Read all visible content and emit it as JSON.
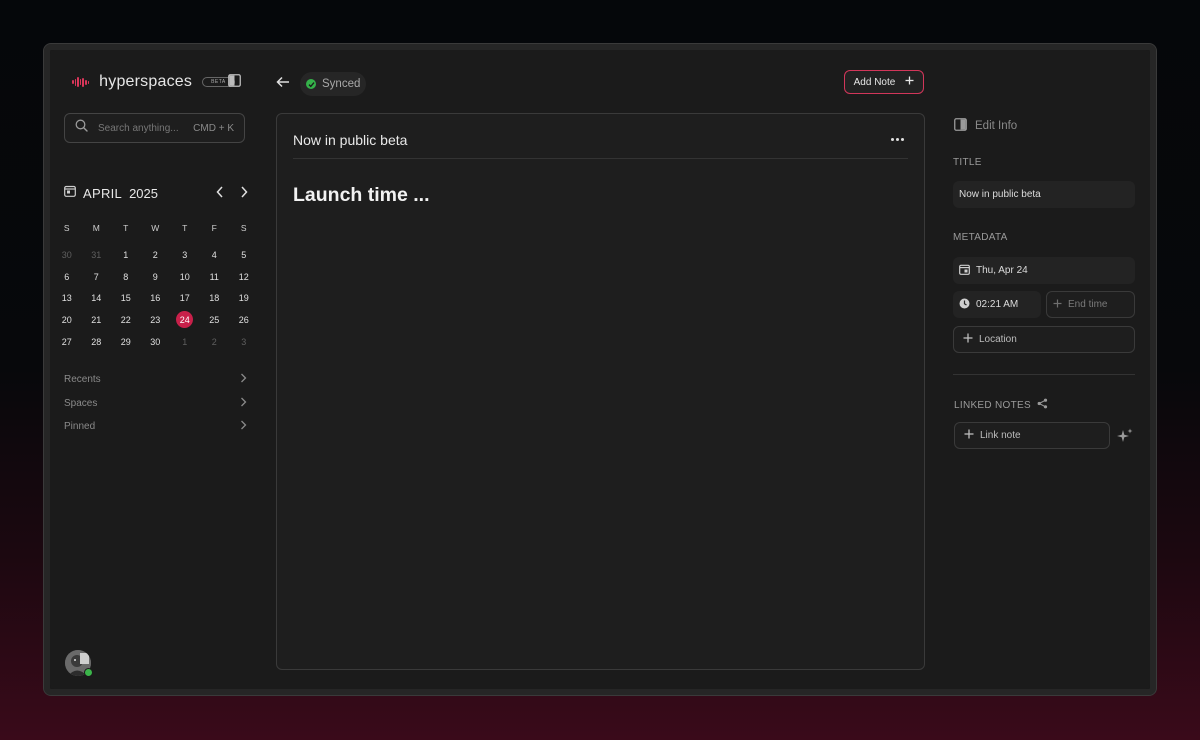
{
  "app": {
    "name": "hyperspaces",
    "badge": "BETA"
  },
  "search": {
    "placeholder": "Search anything...",
    "shortcut": "CMD + K"
  },
  "calendar": {
    "month": "APRIL",
    "year": "2025",
    "weekdays": [
      "S",
      "M",
      "T",
      "W",
      "T",
      "F",
      "S"
    ],
    "days": [
      {
        "d": "30",
        "m": true
      },
      {
        "d": "31",
        "m": true
      },
      {
        "d": "1"
      },
      {
        "d": "2"
      },
      {
        "d": "3"
      },
      {
        "d": "4"
      },
      {
        "d": "5"
      },
      {
        "d": "6"
      },
      {
        "d": "7"
      },
      {
        "d": "8"
      },
      {
        "d": "9"
      },
      {
        "d": "10"
      },
      {
        "d": "11"
      },
      {
        "d": "12"
      },
      {
        "d": "13"
      },
      {
        "d": "14"
      },
      {
        "d": "15"
      },
      {
        "d": "16"
      },
      {
        "d": "17"
      },
      {
        "d": "18"
      },
      {
        "d": "19"
      },
      {
        "d": "20"
      },
      {
        "d": "21"
      },
      {
        "d": "22"
      },
      {
        "d": "23"
      },
      {
        "d": "24",
        "today": true
      },
      {
        "d": "25"
      },
      {
        "d": "26"
      },
      {
        "d": "27"
      },
      {
        "d": "28"
      },
      {
        "d": "29"
      },
      {
        "d": "30"
      },
      {
        "d": "1",
        "m": true
      },
      {
        "d": "2",
        "m": true
      },
      {
        "d": "3",
        "m": true
      }
    ]
  },
  "nav": {
    "items": [
      {
        "label": "Recents"
      },
      {
        "label": "Spaces"
      },
      {
        "label": "Pinned"
      }
    ]
  },
  "topbar": {
    "status": "Synced",
    "add_note": "Add Note"
  },
  "editor": {
    "title": "Now in public beta",
    "heading": "Launch time ..."
  },
  "info": {
    "header": "Edit Info",
    "title_label": "TITLE",
    "title_value": "Now in public beta",
    "metadata_label": "METADATA",
    "date": "Thu, Apr 24",
    "time": "02:21 AM",
    "end_time_placeholder": "End time",
    "location_placeholder": "Location",
    "linked_label": "LINKED NOTES",
    "link_note": "Link note"
  },
  "colors": {
    "accent": "#c8204a",
    "synced": "#35b24a",
    "online": "#3bb54a"
  }
}
